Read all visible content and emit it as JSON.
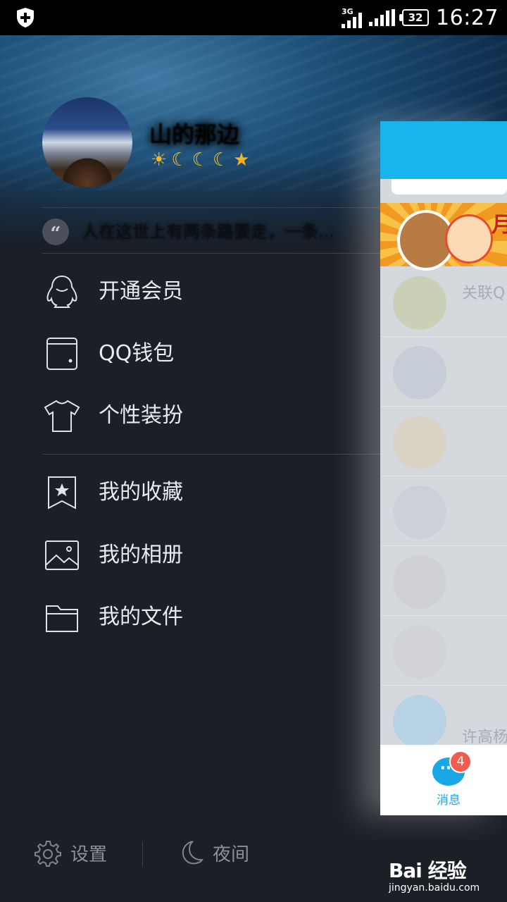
{
  "status_bar": {
    "network": "3G",
    "battery": "32",
    "time": "16:27"
  },
  "profile": {
    "nickname": "山的那边",
    "signature": "人在这世上有两条路要走，一条..."
  },
  "menu": {
    "group1": [
      {
        "label": "开通会员",
        "icon": "penguin-icon"
      },
      {
        "label": "QQ钱包",
        "icon": "wallet-icon"
      },
      {
        "label": "个性装扮",
        "icon": "tshirt-icon"
      }
    ],
    "group2": [
      {
        "label": "我的收藏",
        "icon": "bookmark-star-icon"
      },
      {
        "label": "我的相册",
        "icon": "photo-icon"
      },
      {
        "label": "我的文件",
        "icon": "folder-icon"
      }
    ]
  },
  "bottom_bar": {
    "settings": "设置",
    "night": "夜间"
  },
  "peek_panel": {
    "chat_names": [
      "关联Q",
      "",
      "",
      "",
      "",
      "",
      "许高杨"
    ],
    "tab_label": "消息",
    "tab_badge": "4"
  },
  "watermark": {
    "logo": "Bai 经验",
    "url": "jingyan.baidu.com"
  },
  "colors": {
    "drawer_bg": "#1b1f26",
    "accent": "#18b4ed",
    "badge": "#f25b4d"
  }
}
